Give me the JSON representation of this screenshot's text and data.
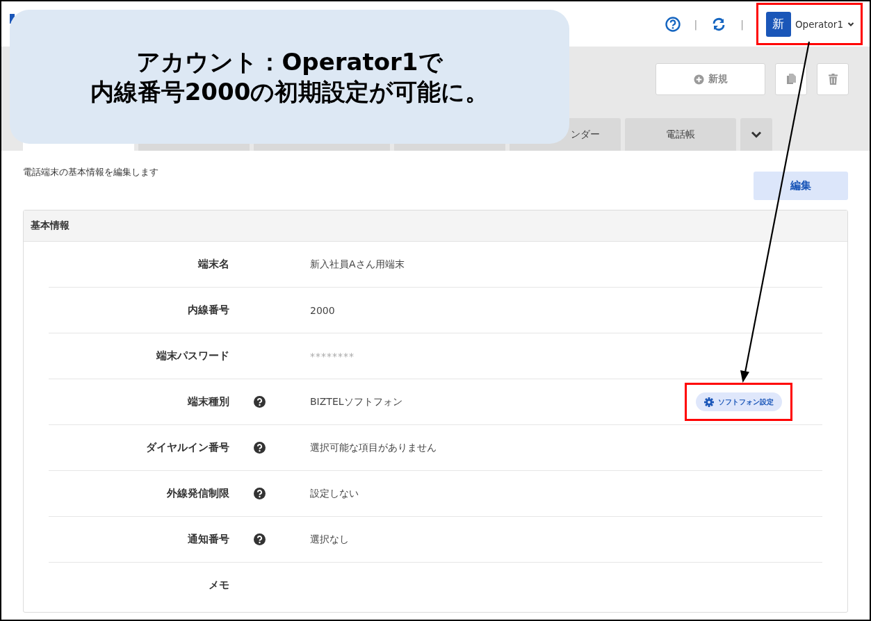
{
  "header": {
    "avatar": "新",
    "user_name": "Operator1",
    "separators": [
      "|",
      "|"
    ]
  },
  "callout": {
    "lines": [
      "アカウント：Operator1で",
      "内線番号2000の初期設定が可能に。"
    ]
  },
  "toolbar": {
    "new_button": "新規"
  },
  "tabs": [
    {
      "kind": "tab",
      "selected": true
    },
    {
      "kind": "tab",
      "selected": false
    },
    {
      "kind": "tab",
      "selected": false
    },
    {
      "kind": "tab",
      "selected": false
    },
    {
      "kind": "tab",
      "label": "ンダー",
      "selected": false
    },
    {
      "kind": "tab",
      "label": "電話帳",
      "selected": false
    },
    {
      "kind": "more",
      "selected": false
    }
  ],
  "description": "電話端末の基本情報を編集します",
  "edit_button": "編集",
  "section": {
    "title": "基本情報",
    "rows": [
      {
        "label": "端末名",
        "help": false,
        "value": "新入社員Aさん用端末"
      },
      {
        "label": "内線番号",
        "help": false,
        "value": "2000"
      },
      {
        "label": "端末パスワード",
        "help": false,
        "value": "********",
        "kind": "masked"
      },
      {
        "label": "端末種別",
        "help": true,
        "value": "BIZTELソフトフォン",
        "action": "ソフトフォン設定"
      },
      {
        "label": "ダイヤルイン番号",
        "help": true,
        "value": "選択可能な項目がありません"
      },
      {
        "label": "外線発信制限",
        "help": true,
        "value": "設定しない"
      },
      {
        "label": "通知番号",
        "help": true,
        "value": "選択なし"
      },
      {
        "label": "メモ",
        "help": false
      }
    ]
  }
}
